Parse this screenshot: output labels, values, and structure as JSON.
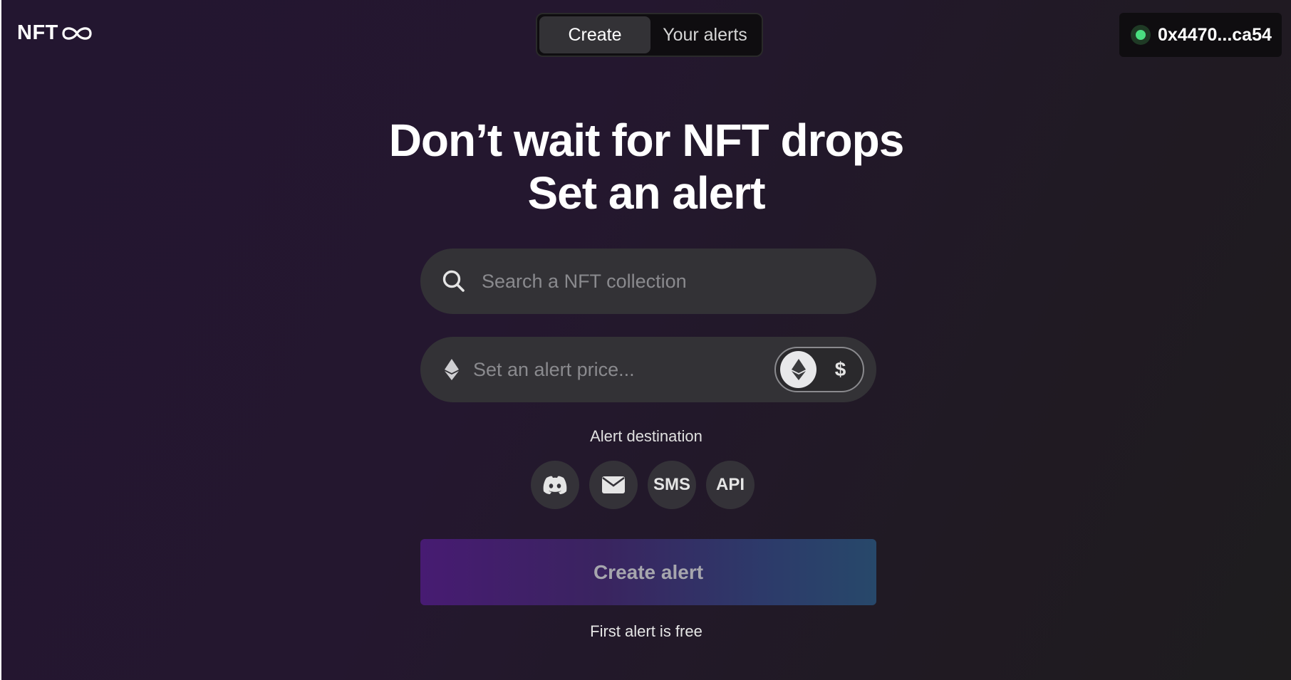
{
  "header": {
    "logo_text": "NFT",
    "logo_icon": "infinity-icon",
    "tabs": [
      {
        "label": "Create",
        "active": true
      },
      {
        "label": "Your alerts",
        "active": false
      }
    ],
    "wallet": {
      "address": "0x4470...ca54",
      "status_color": "#4ade80"
    }
  },
  "hero": {
    "line1": "Don’t wait for NFT drops",
    "line2": "Set an alert"
  },
  "search": {
    "placeholder": "Search a NFT collection",
    "icon": "search-icon"
  },
  "price": {
    "placeholder": "Set an alert price...",
    "icon": "ethereum-icon",
    "currency_options": [
      {
        "name": "ethereum-icon",
        "selected": true
      },
      {
        "label": "$",
        "selected": false
      }
    ]
  },
  "destination": {
    "label": "Alert destination",
    "options": [
      {
        "name": "discord-icon"
      },
      {
        "name": "email-icon"
      },
      {
        "label": "SMS"
      },
      {
        "label": "API"
      }
    ]
  },
  "cta": {
    "label": "Create alert",
    "note": "First alert is free",
    "gradient": [
      "#471b72",
      "#27486a"
    ]
  }
}
